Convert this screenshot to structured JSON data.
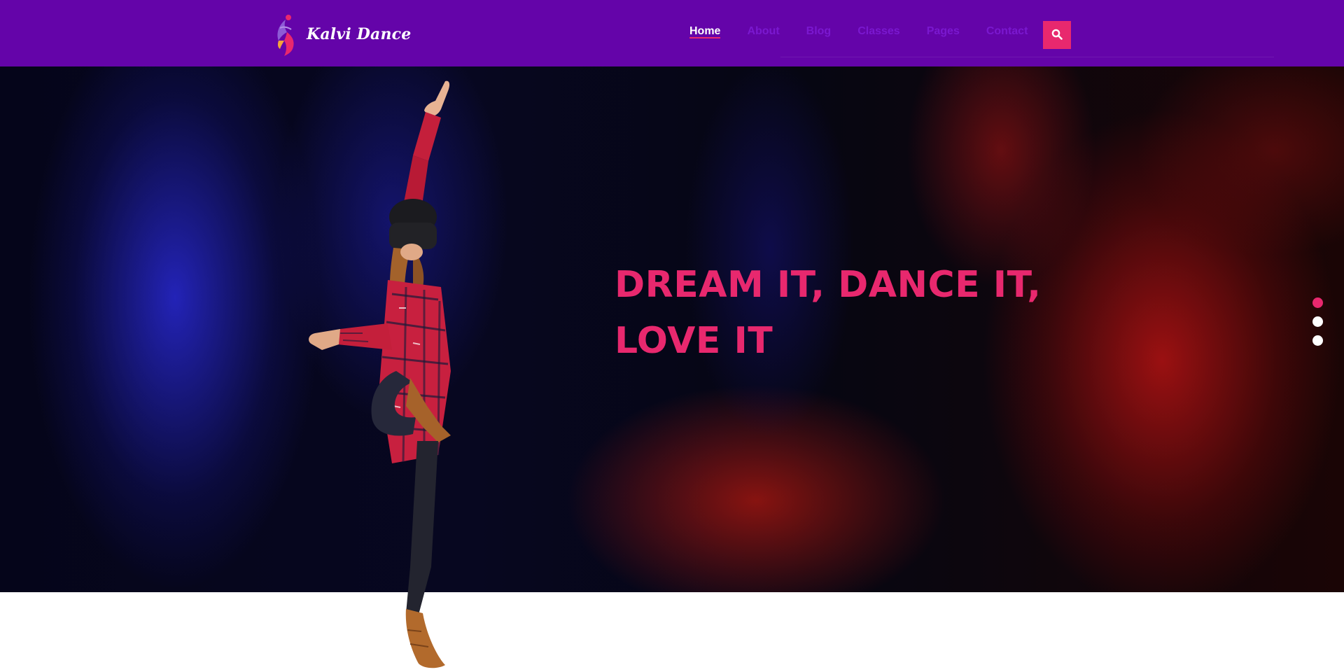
{
  "brand": {
    "name": "Kalvi Dance",
    "colors": {
      "header_bg": "#6404a9",
      "accent": "#e8286e",
      "nav_inactive": "#7a18cf"
    }
  },
  "nav": {
    "items": [
      {
        "label": "Home",
        "active": true
      },
      {
        "label": "About",
        "active": false
      },
      {
        "label": "Blog",
        "active": false
      },
      {
        "label": "Classes",
        "active": false
      },
      {
        "label": "Pages",
        "active": false
      },
      {
        "label": "Contact",
        "active": false
      }
    ],
    "search_icon": "search-icon"
  },
  "hero": {
    "headline_line1": "DREAM IT, DANCE IT,",
    "headline_line2": "LOVE IT",
    "image": "dancer-in-plaid-shirt",
    "slides": {
      "count": 3,
      "active_index": 0
    }
  }
}
